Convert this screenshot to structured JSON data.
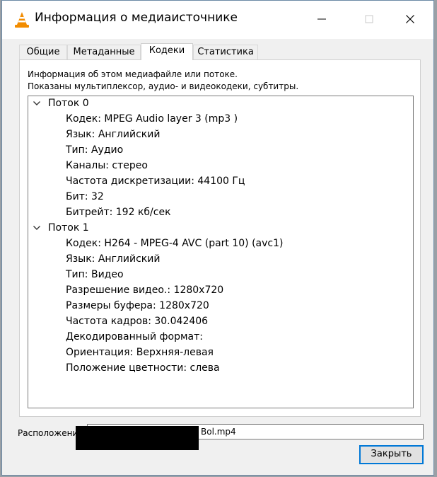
{
  "window": {
    "title": "Информация о медиаисточнике",
    "accent": "#0078d7"
  },
  "tabs": [
    {
      "label": "Общие",
      "active": false
    },
    {
      "label": "Метаданные",
      "active": false
    },
    {
      "label": "Кодеки",
      "active": true
    },
    {
      "label": "Статистика",
      "active": false
    }
  ],
  "panel": {
    "desc_line1": "Информация об этом медиафайле или потоке.",
    "desc_line2": "Показаны мультиплексор, аудио- и видеокодеки, субтитры."
  },
  "streams": [
    {
      "label": "Поток 0",
      "expanded": true,
      "items": [
        "Кодек: MPEG Audio layer 3 (mp3 )",
        "Язык: Английский",
        "Тип: Аудио",
        "Каналы: стерео",
        "Частота дискретизации: 44100 Гц",
        "Бит: 32",
        "Битрейт: 192 кб/сек"
      ]
    },
    {
      "label": "Поток 1",
      "expanded": true,
      "items": [
        "Кодек: H264 - MPEG-4 AVC (part 10) (avc1)",
        "Язык: Английский",
        "Тип: Видео",
        "Разрешение видео.: 1280x720",
        "Размеры буфера: 1280x720",
        "Частота кадров: 30.042406",
        "Декодированный формат:",
        "Ориентация: Верхняя-левая",
        "Положение цветности: слева"
      ]
    }
  ],
  "footer": {
    "location_label": "Расположение:",
    "location_value": "Bol.mp4",
    "close_label": "Закрыть"
  }
}
